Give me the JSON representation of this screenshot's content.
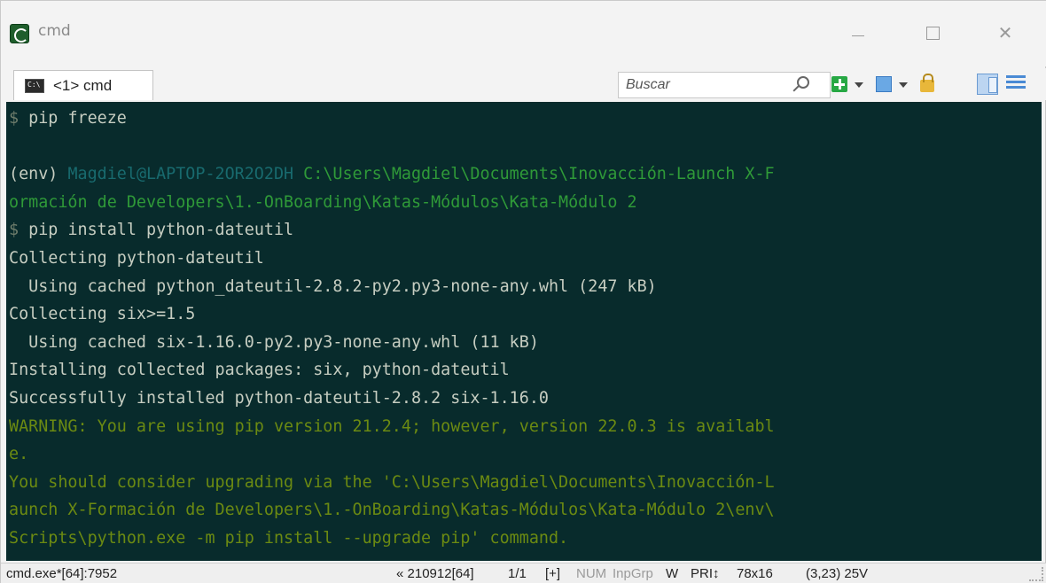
{
  "window": {
    "title": "cmd",
    "controls": {
      "minimize": "—",
      "close": "✕"
    }
  },
  "tabs": [
    {
      "label": "<1> cmd",
      "icon": "console-icon"
    }
  ],
  "search": {
    "placeholder": "Buscar"
  },
  "console": {
    "lines": [
      {
        "segments": [
          {
            "text": "$ ",
            "style": "prompt"
          },
          {
            "text": "pip freeze",
            "style": "text"
          }
        ]
      },
      {
        "segments": []
      },
      {
        "segments": [
          {
            "text": "(env) ",
            "style": "text"
          },
          {
            "text": "Magdiel@LAPTOP-2OR2O2DH ",
            "style": "user"
          },
          {
            "text": "C:\\Users\\Magdiel\\Documents\\Inovacción-Launch X-F",
            "style": "green"
          }
        ]
      },
      {
        "segments": [
          {
            "text": "ormación de Developers\\1.-OnBoarding\\Katas-Módulos\\Kata-Módulo 2",
            "style": "green"
          }
        ]
      },
      {
        "segments": [
          {
            "text": "$ ",
            "style": "prompt"
          },
          {
            "text": "pip install python-dateutil",
            "style": "text"
          }
        ]
      },
      {
        "segments": [
          {
            "text": "Collecting python-dateutil",
            "style": "text"
          }
        ]
      },
      {
        "segments": [
          {
            "text": "  Using cached python_dateutil-2.8.2-py2.py3-none-any.whl (247 kB)",
            "style": "text"
          }
        ]
      },
      {
        "segments": [
          {
            "text": "Collecting six>=1.5",
            "style": "text"
          }
        ]
      },
      {
        "segments": [
          {
            "text": "  Using cached six-1.16.0-py2.py3-none-any.whl (11 kB)",
            "style": "text"
          }
        ]
      },
      {
        "segments": [
          {
            "text": "Installing collected packages: six, python-dateutil",
            "style": "text"
          }
        ]
      },
      {
        "segments": [
          {
            "text": "Successfully installed python-dateutil-2.8.2 six-1.16.0",
            "style": "text"
          }
        ]
      },
      {
        "segments": [
          {
            "text": "WARNING: You are using pip version 21.2.4; however, version 22.0.3 is availabl",
            "style": "warn"
          }
        ]
      },
      {
        "segments": [
          {
            "text": "e.",
            "style": "warn"
          }
        ]
      },
      {
        "segments": [
          {
            "text": "You should consider upgrading via the 'C:\\Users\\Magdiel\\Documents\\Inovacción-L",
            "style": "warn"
          }
        ]
      },
      {
        "segments": [
          {
            "text": "aunch X-Formación de Developers\\1.-OnBoarding\\Katas-Módulos\\Kata-Módulo 2\\env\\",
            "style": "warn"
          }
        ]
      },
      {
        "segments": [
          {
            "text": "Scripts\\python.exe -m pip install --upgrade pip' command.",
            "style": "warn"
          }
        ]
      }
    ]
  },
  "status": {
    "process": "cmd.exe*[64]:7952",
    "build": "« 210912[64]",
    "console_index": "1/1",
    "plus": "[+]",
    "num": "NUM",
    "inpgrp": "InpGrp",
    "w": "W",
    "pri": "PRI↕",
    "size": "78x16",
    "cursor": "(3,23) 25V"
  },
  "colors": {
    "console_bg": "#082b2c",
    "console_text": "#c6cdc1",
    "path_green": "#2f9a38",
    "user_teal": "#186a6e",
    "warning": "#6b8a12"
  }
}
